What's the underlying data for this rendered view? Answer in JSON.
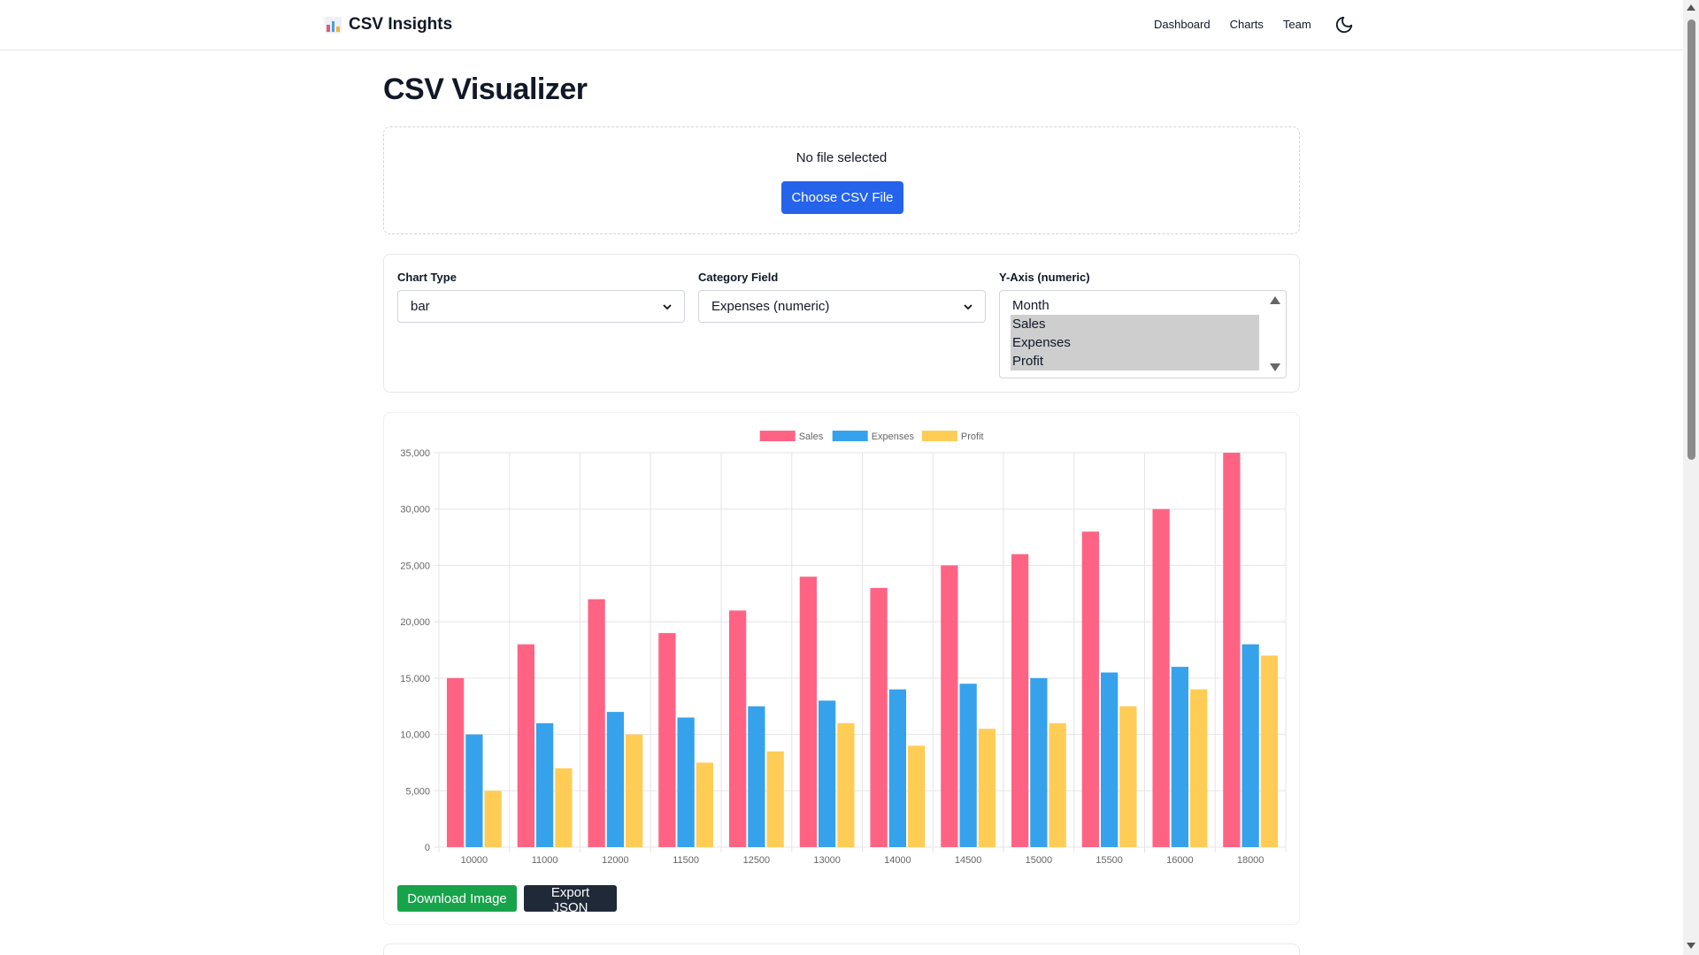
{
  "navbar": {
    "brand_title": "CSV Insights",
    "brand_icon": "bar-chart-emoji-icon",
    "links": [
      "Dashboard",
      "Charts",
      "Team"
    ],
    "theme_icon": "moon-icon"
  },
  "page": {
    "title": "CSV Visualizer"
  },
  "upload": {
    "status": "No file selected",
    "button_label": "Choose CSV File"
  },
  "controls": {
    "chart_type_label": "Chart Type",
    "chart_type_value": "bar",
    "category_label": "Category Field",
    "category_value": "Expenses (numeric)",
    "yaxis_label": "Y-Axis (numeric)",
    "yaxis_options": [
      "Month",
      "Sales",
      "Expenses",
      "Profit"
    ],
    "yaxis_selected": [
      "Sales",
      "Expenses",
      "Profit"
    ]
  },
  "actions": {
    "download_label": "Download Image",
    "export_label": "Export JSON"
  },
  "chart_data": {
    "type": "bar",
    "categories": [
      "10000",
      "11000",
      "12000",
      "11500",
      "12500",
      "13000",
      "14000",
      "14500",
      "15000",
      "15500",
      "16000",
      "18000"
    ],
    "series": [
      {
        "name": "Sales",
        "color": "#ff6384",
        "values": [
          15000,
          18000,
          22000,
          19000,
          21000,
          24000,
          23000,
          25000,
          26000,
          28000,
          30000,
          35000
        ]
      },
      {
        "name": "Expenses",
        "color": "#36a2eb",
        "values": [
          10000,
          11000,
          12000,
          11500,
          12500,
          13000,
          14000,
          14500,
          15000,
          15500,
          16000,
          18000
        ]
      },
      {
        "name": "Profit",
        "color": "#ffcd56",
        "values": [
          5000,
          7000,
          10000,
          7500,
          8500,
          11000,
          9000,
          10500,
          11000,
          12500,
          14000,
          17000
        ]
      }
    ],
    "yticks": [
      "0",
      "5,000",
      "10,000",
      "15,000",
      "20,000",
      "25,000",
      "30,000",
      "35,000"
    ],
    "ylim": [
      0,
      35000
    ],
    "grid": true,
    "legend": "top-center",
    "title": "",
    "xlabel": "",
    "ylabel": ""
  }
}
